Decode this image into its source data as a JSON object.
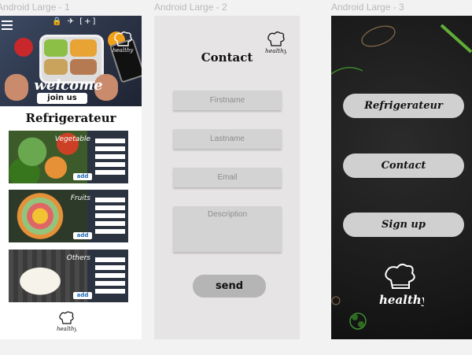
{
  "frames": [
    {
      "title": "Android Large - 1"
    },
    {
      "title": "Android Large - 2"
    },
    {
      "title": "Android Large - 3"
    }
  ],
  "frame1": {
    "status_icons": "🔒 ✈ [+]",
    "hero_welcome": "welcome",
    "hero_button": "join us",
    "heading": "Refrigerateur",
    "cards": [
      {
        "label": "Vegetable",
        "add": "add"
      },
      {
        "label": "Fruits",
        "add": "add"
      },
      {
        "label": "Others",
        "add": "add"
      }
    ],
    "logo_text": "healthy"
  },
  "frame2": {
    "title": "Contact",
    "logo_text": "healthy",
    "placeholders": {
      "firstname": "Firstname",
      "lastname": "Lastname",
      "email": "Email",
      "description": "Description"
    },
    "send": "send"
  },
  "frame3": {
    "buttons": [
      "Refrigerateur",
      "Contact",
      "Sign up"
    ],
    "logo_text": "healthy"
  },
  "colors": {
    "canvas": "#f2f2f2",
    "frame2_bg": "#e6e4e4",
    "frame3_bg": "#1e1e1e",
    "button_grey": "#d0d0d0",
    "add_text": "#1c6ab5"
  }
}
